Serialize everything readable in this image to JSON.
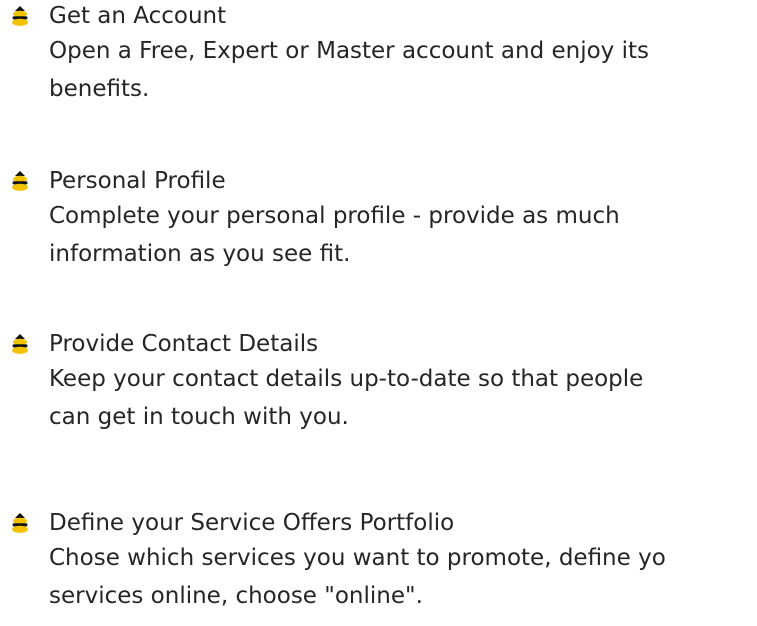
{
  "steps": [
    {
      "title": "Get an Account",
      "description_lines": [
        "Open a Free, Expert or Master account and enjoy its",
        "benefits."
      ],
      "icon": "bee-bullet-icon"
    },
    {
      "title": "Personal Profile",
      "description_lines": [
        "Complete your personal profile - provide as much",
        "information as you see fit."
      ],
      "icon": "bee-bullet-icon"
    },
    {
      "title": "Provide Contact Details",
      "description_lines": [
        "Keep your contact details up-to-date so that people",
        "can get in touch with you."
      ],
      "icon": "bee-bullet-icon"
    },
    {
      "title": "Define your Service Offers Portfolio",
      "description_lines": [
        "Chose which services you want to promote, define yo",
        "services online, choose \"online\"."
      ],
      "icon": "bee-bullet-icon"
    }
  ],
  "colors": {
    "text": "#262626",
    "bee_yellow": "#f2c200",
    "bee_black": "#111111",
    "background": "#ffffff"
  }
}
